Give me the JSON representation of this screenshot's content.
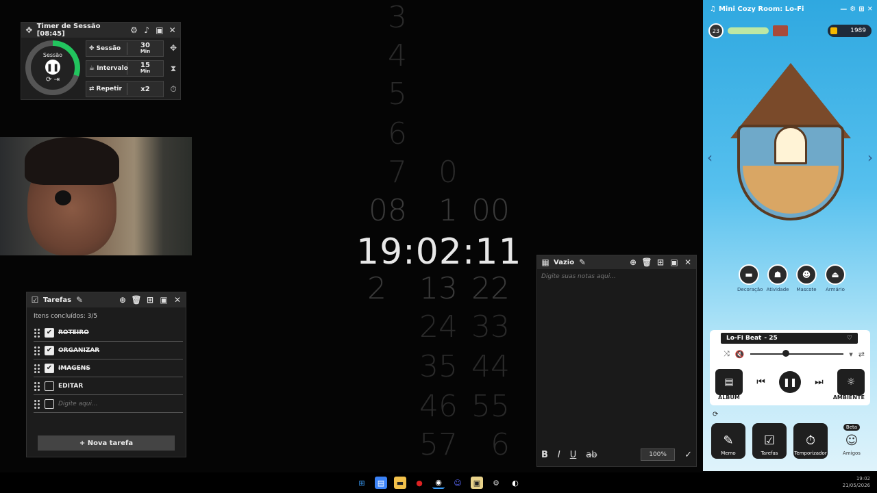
{
  "timer": {
    "title": "Timer de Sessão [08:45]",
    "ring_label": "Sessão",
    "ring_progress": 0.3,
    "rows": [
      {
        "label": "Sessão",
        "value": "30",
        "unit": "Min"
      },
      {
        "label": "Intervalo",
        "value": "15",
        "unit": "Min"
      },
      {
        "label": "Repetir",
        "value": "x2",
        "unit": ""
      }
    ]
  },
  "tasks": {
    "title": "Tarefas",
    "completed": "Itens concluídos: 3/5",
    "items": [
      {
        "label": "ROTEIRO",
        "done": true
      },
      {
        "label": "ORGANIZAR",
        "done": true
      },
      {
        "label": "IMAGENS",
        "done": true
      },
      {
        "label": "EDITAR",
        "done": false
      }
    ],
    "input_placeholder": "Digite aqui...",
    "new_task": "+ Nova tarefa"
  },
  "clock": {
    "time": "19:02:11",
    "hours_col": [
      "3",
      "4",
      "5",
      "6",
      "7",
      "08",
      "2"
    ],
    "minutes_col": [
      "0",
      "1",
      "13",
      "24",
      "35",
      "46",
      "57"
    ],
    "seconds_col": [
      "00",
      "22",
      "33",
      "44",
      "55",
      "6"
    ]
  },
  "notes": {
    "title": "Vazio",
    "placeholder": "Digite suas notas aqui...",
    "zoom": "100%",
    "format_buttons": [
      "B",
      "I",
      "U",
      "ab"
    ]
  },
  "cozy": {
    "title": "Mini Cozy Room: Lo-Fi",
    "level": "23",
    "coins": "1989",
    "actions": [
      "Decoração",
      "Atividade",
      "Mascote",
      "Armário"
    ],
    "track": "Lo-Fi Beat",
    "track_num": "- 25",
    "album_label": "ÁLBUM",
    "ambient_label": "AMBIENTE",
    "dock": [
      {
        "label": "Memo"
      },
      {
        "label": "Tarefas"
      },
      {
        "label": "Temporizador"
      },
      {
        "label": "Amigos",
        "badge": "Beta"
      }
    ],
    "accent": "#2fa8e0"
  },
  "system": {
    "time": "19:02",
    "date": "21/05/2026"
  }
}
